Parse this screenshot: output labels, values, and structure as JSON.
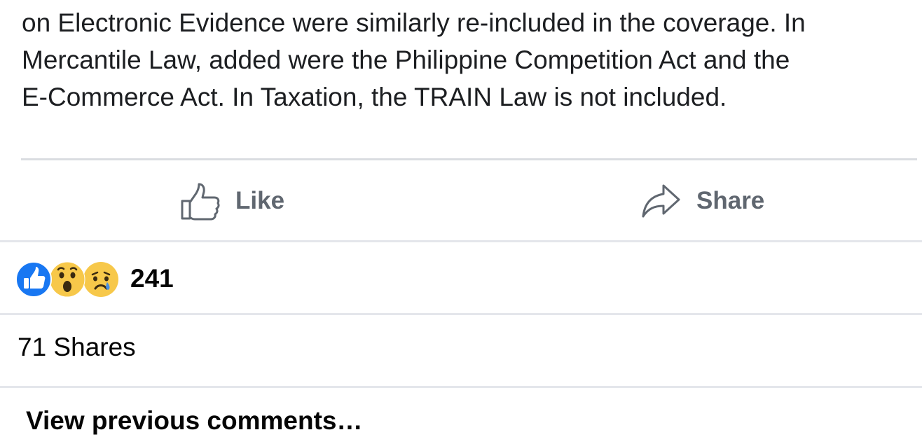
{
  "post": {
    "text_lines": [
      "on Electronic Evidence were similarly re-included in the coverage. In",
      "Mercantile Law, added were the Philippine Competition Act and the",
      "E-Commerce Act. In Taxation, the TRAIN Law is not included."
    ]
  },
  "actions": {
    "like_label": "Like",
    "share_label": "Share",
    "like_icon": "thumbs-up-outline-icon",
    "share_icon": "share-arrow-icon",
    "label_color": "#606770"
  },
  "reactions": {
    "types": [
      "like",
      "wow",
      "sad"
    ],
    "count": "241",
    "like_color": "#1877f2",
    "emoji_color": "#f7c84a"
  },
  "shares": {
    "label": "71 Shares"
  },
  "comments": {
    "view_previous_label": "View previous comments…"
  }
}
